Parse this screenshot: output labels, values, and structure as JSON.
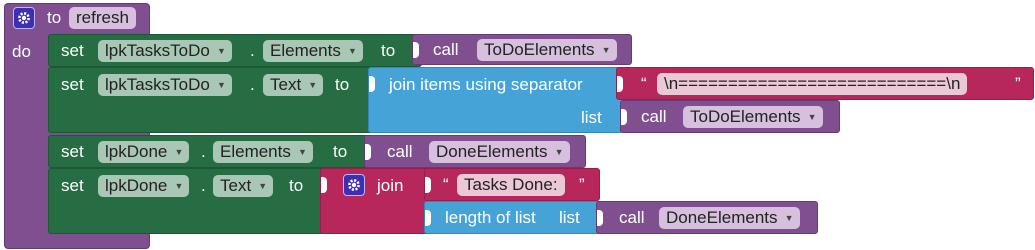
{
  "procedure": {
    "to_label": "to",
    "name": "refresh",
    "do_label": "do"
  },
  "kw": {
    "set": "set",
    "to": "to",
    "dot": ".",
    "call": "call",
    "join": "join",
    "list": "list",
    "quote_open": "“",
    "quote_close": "”"
  },
  "rows": [
    {
      "component": "lpkTasksToDo",
      "property": "Elements",
      "call_proc": "ToDoElements"
    },
    {
      "component": "lpkTasksToDo",
      "property": "Text",
      "join_label": "join items using separator",
      "separator": "\\n===========================\\n",
      "list_call": "ToDoElements"
    },
    {
      "component": "lpkDone",
      "property": "Elements",
      "call_proc": "DoneElements"
    },
    {
      "component": "lpkDone",
      "property": "Text",
      "text": "Tasks Done:",
      "length_label": "length of list",
      "length_call": "DoneElements"
    }
  ],
  "icons": {
    "gear": "gear-icon",
    "dropdown": "dropdown-arrow-icon"
  }
}
